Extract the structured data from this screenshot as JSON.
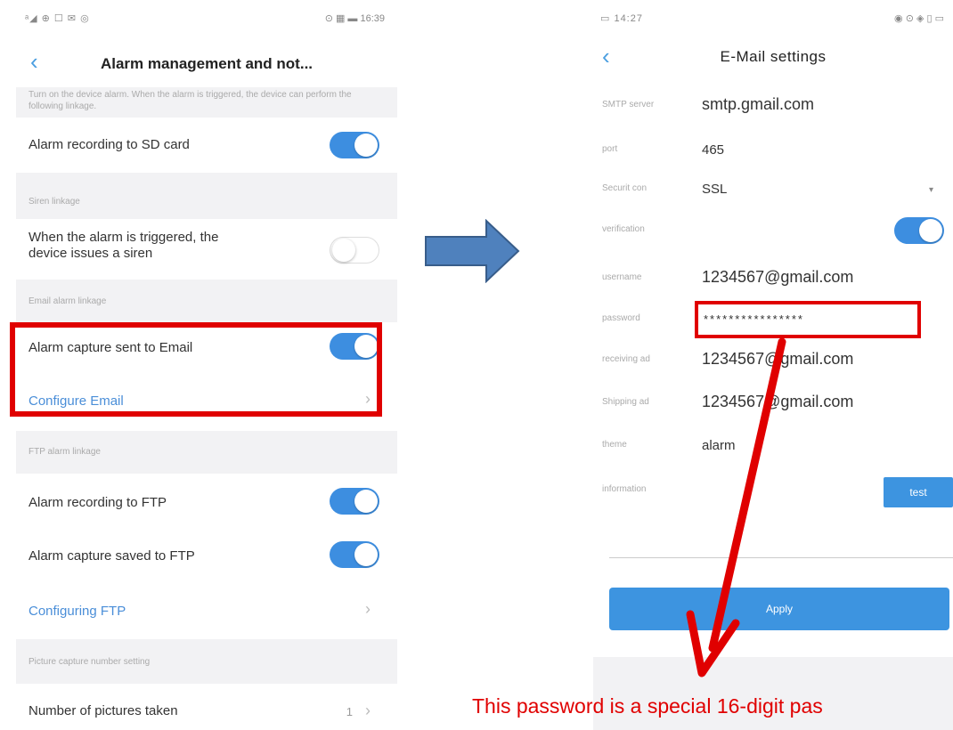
{
  "left": {
    "status_left": "ᵃ◢ ⊕ ☐ ✉ ◎",
    "status_right": "⊙ ▦ ▬ 16:39",
    "title": "Alarm management and not...",
    "intro": "Turn on the device alarm. When the alarm is triggered, the device can perform the following linkage.",
    "alarm_sd": "Alarm recording to SD card",
    "siren_section": "Siren linkage",
    "siren_line1": "When the alarm is triggered, the",
    "siren_line2": "device issues a siren",
    "email_section": "Email alarm linkage",
    "email_capture": "Alarm capture sent to Email",
    "configure_email": "Configure Email",
    "ftp_section": "FTP alarm linkage",
    "ftp_recording": "Alarm recording to FTP",
    "ftp_capture": "Alarm capture saved to FTP",
    "configure_ftp": "Configuring FTP",
    "capture_section": "Picture capture number setting",
    "pictures_label": "Number of pictures taken",
    "pictures_value": "1"
  },
  "right": {
    "status_left": "▭ 14:27",
    "status_right": "◉ ⊙ ◈ ▯ ▭",
    "title": "E-Mail settings",
    "fields": [
      {
        "label": "SMTP server",
        "value": "smtp.gmail.com"
      },
      {
        "label": "port",
        "value": "465"
      },
      {
        "label": "Securit con",
        "value": "SSL"
      },
      {
        "label": "verification",
        "value": ""
      },
      {
        "label": "username",
        "value": "1234567@gmail.com"
      },
      {
        "label": "password",
        "value": "****************"
      },
      {
        "label": "receiving ad",
        "value": "1234567@gmail.com"
      },
      {
        "label": "Shipping ad",
        "value": "1234567@gmail.com"
      },
      {
        "label": "theme",
        "value": "alarm"
      },
      {
        "label": "information",
        "value": ""
      }
    ],
    "test_label": "test",
    "apply_label": "Apply"
  },
  "caption": "This password is a special 16-digit pas",
  "colors": {
    "accent": "#3d94e0",
    "highlight": "#e00000"
  }
}
